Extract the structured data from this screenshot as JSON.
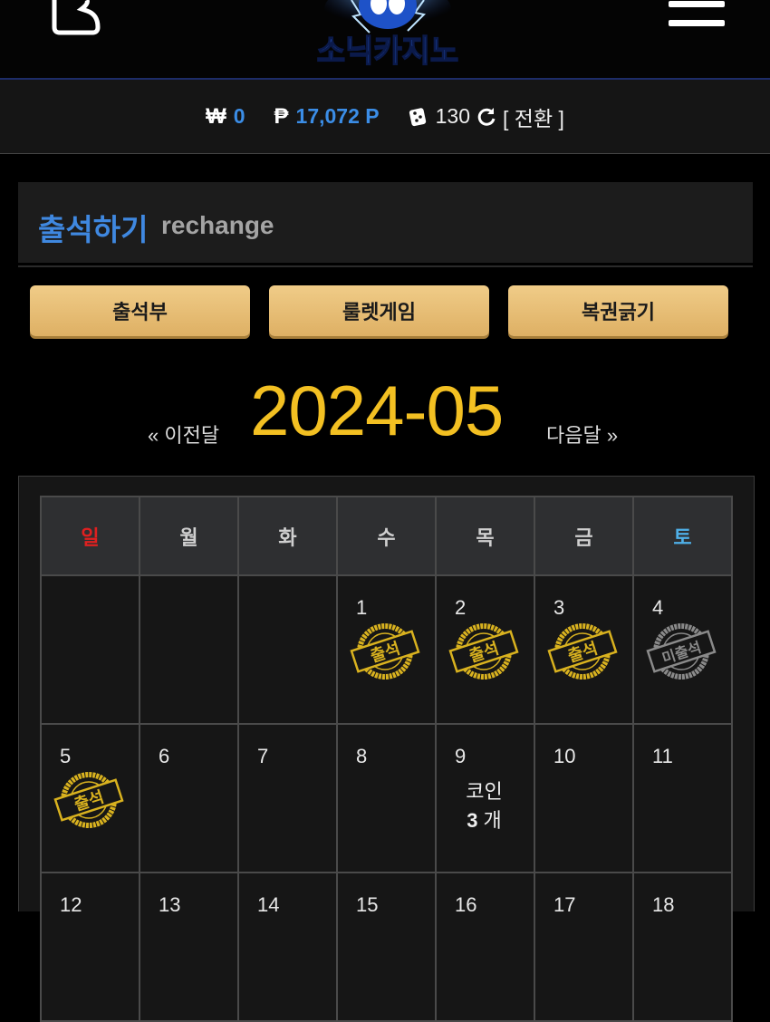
{
  "header": {
    "logo_text": "소닉카지노",
    "user_icon": "user-icon",
    "menu_icon": "hamburger-menu-icon"
  },
  "balance": {
    "won_symbol": "₩",
    "won_value": "0",
    "point_symbol": "₱",
    "point_value": "17,072 P",
    "dice_value": "130",
    "switch_label": "[ 전환 ]"
  },
  "section": {
    "title": "출석하기",
    "subtitle": "rechange"
  },
  "tabs": [
    {
      "label": "출석부"
    },
    {
      "label": "룰렛게임"
    },
    {
      "label": "복권긁기"
    }
  ],
  "month_nav": {
    "prev": "« 이전달",
    "current": "2024-05",
    "next": "다음달 »"
  },
  "calendar": {
    "weekdays": [
      "일",
      "월",
      "화",
      "수",
      "목",
      "금",
      "토"
    ],
    "weekday_colors": {
      "sun": "#e02020",
      "sat": "#4fb0e8",
      "default": "#cfcfcf"
    },
    "week1": [
      {
        "day": ""
      },
      {
        "day": ""
      },
      {
        "day": ""
      },
      {
        "day": "1",
        "stamp": "출석"
      },
      {
        "day": "2",
        "stamp": "출석"
      },
      {
        "day": "3",
        "stamp": "출석"
      },
      {
        "day": "4",
        "stamp": "미출석"
      }
    ],
    "week2": [
      {
        "day": "5",
        "stamp": "출석"
      },
      {
        "day": "6"
      },
      {
        "day": "7"
      },
      {
        "day": "8"
      },
      {
        "day": "9",
        "coin_label": "코인",
        "coin_amount": "3",
        "coin_unit": "개"
      },
      {
        "day": "10"
      },
      {
        "day": "11"
      }
    ],
    "week3": [
      {
        "day": "12"
      },
      {
        "day": "13"
      },
      {
        "day": "14"
      },
      {
        "day": "15"
      },
      {
        "day": "16"
      },
      {
        "day": "17"
      },
      {
        "day": "18"
      }
    ]
  },
  "colors": {
    "accent_blue": "#3b8de6",
    "month_yellow": "#f3c022",
    "button_gold": "#e8be76",
    "stamp_gold": "#d9b21f",
    "stamp_gray": "#8a8a8a"
  }
}
